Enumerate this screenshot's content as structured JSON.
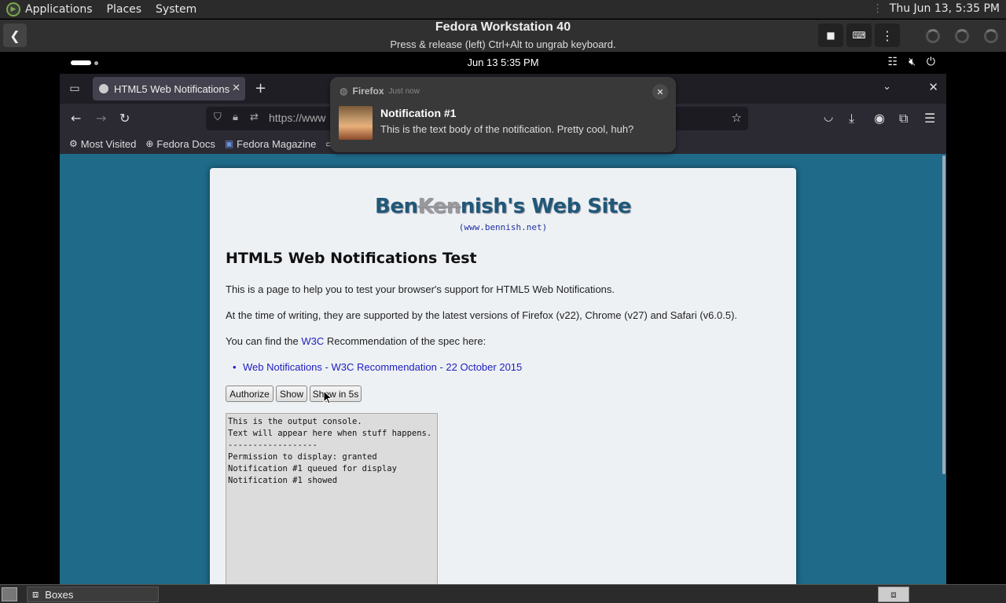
{
  "host_panel": {
    "menus": [
      "Applications",
      "Places",
      "System"
    ],
    "clock": "Thu Jun 13,  5:35 PM"
  },
  "boxes": {
    "title": "Fedora Workstation 40",
    "subtitle": "Press & release (left) Ctrl+Alt to ungrab keyboard."
  },
  "guest_topbar": {
    "clock": "Jun 13    5:35 PM"
  },
  "firefox": {
    "tab_title": "HTML5 Web Notifications",
    "url": "https://www",
    "bookmarks": [
      "Most Visited",
      "Fedora Docs",
      "Fedora Magazine"
    ]
  },
  "notification": {
    "app": "Firefox",
    "time": "Just now",
    "title": "Notification #1",
    "body": "This is the text body of the notification.  Pretty cool, huh?"
  },
  "page": {
    "site_title_pre": "Ben",
    "site_title_strike": "Ken",
    "site_title_post": "nish's Web Site",
    "site_url": "(www.bennish.net)",
    "heading": "HTML5 Web Notifications Test",
    "para1": "This is a page to help you to test your browser's support for HTML5 Web Notifications.",
    "para2": "At the time of writing, they are supported by the latest versions of Firefox (v22), Chrome (v27) and Safari (v6.0.5).",
    "para3_pre": "You can find the ",
    "para3_link": "W3C",
    "para3_post": " Recommendation of the spec here:",
    "bullet_link": "Web Notifications - W3C Recommendation - 22 October 2015",
    "buttons": {
      "authorize": "Authorize",
      "show": "Show",
      "show_delayed": "Show in 5s"
    },
    "console_lines": "This is the output console.\nText will appear here when stuff happens.\n------------------\nPermission to display: granted\nNotification #1 queued for display\nNotification #1 showed"
  },
  "host_taskbar": {
    "task_label": "Boxes"
  }
}
